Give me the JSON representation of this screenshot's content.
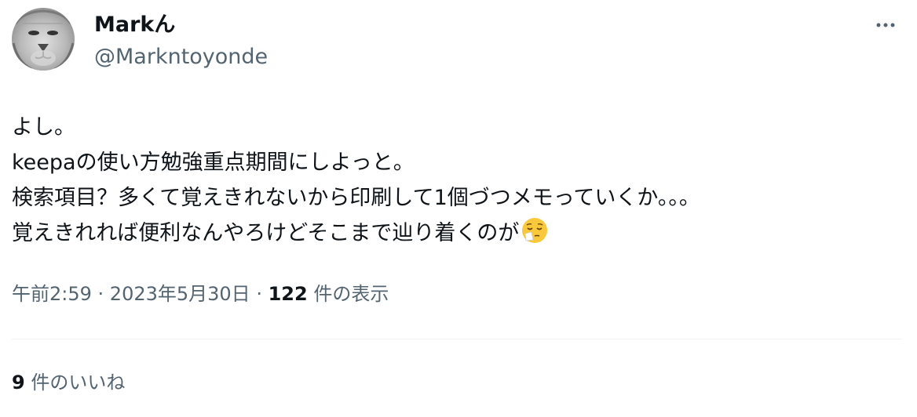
{
  "user": {
    "display_name": "Markん",
    "handle": "@Marknt​oyonde"
  },
  "tweet": {
    "lines": [
      "よし。",
      "keepaの使い方勉強重点期間にしよっと。",
      "検索項目？多くて覚えきれないから印刷して1個づつメモっていくか。。。",
      "覚えきれれば便利なんやろけどそこまで辿り着くのが"
    ],
    "emoji": "relieved-face-with-tissue-emoji"
  },
  "meta": {
    "time": "午前2:59",
    "separator": " · ",
    "date": "2023年5月30日",
    "views_count": "122",
    "views_label": " 件の表示"
  },
  "likes": {
    "count": "9",
    "label": " 件のいいね"
  },
  "colors": {
    "text_primary": "#0f1419",
    "text_secondary": "#536471",
    "divider": "#eff3f4"
  },
  "icons": {
    "more": "more-horizontal-icon"
  }
}
